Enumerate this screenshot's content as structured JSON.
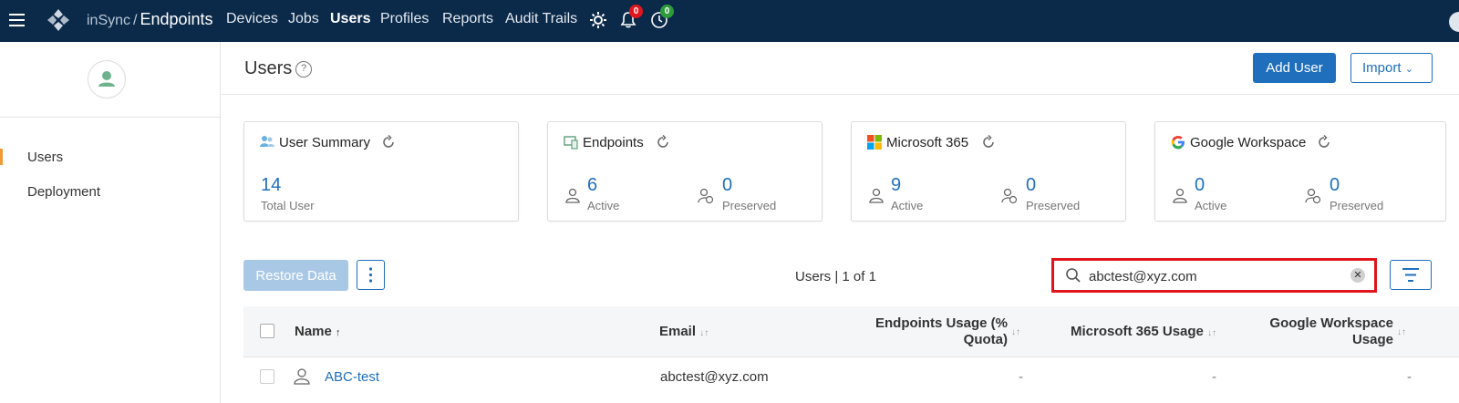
{
  "brand": {
    "prefix": "inSync",
    "separator": "/",
    "product": "Endpoints"
  },
  "nav": [
    "Devices",
    "Jobs",
    "Users",
    "Profiles",
    "Reports",
    "Audit Trails"
  ],
  "nav_active": "Users",
  "badges": {
    "notifications": "0",
    "jobs": "0"
  },
  "colors": {
    "topbar": "#0b2a4a",
    "primary": "#1f6fbd",
    "notif_badge": "#e0151e",
    "jobs_badge": "#2e9a3c",
    "highlight": "#e0151e"
  },
  "sidebar": {
    "items": [
      {
        "label": "Users",
        "active": true
      },
      {
        "label": "Deployment",
        "active": false
      }
    ]
  },
  "page": {
    "title": "Users",
    "add_button": "Add User",
    "import_button": "Import"
  },
  "cards": [
    {
      "title": "User Summary",
      "icon": "users-icon",
      "stats": [
        {
          "value": "14",
          "label": "Total User"
        }
      ]
    },
    {
      "title": "Endpoints",
      "icon": "devices-icon",
      "stats": [
        {
          "value": "6",
          "label": "Active"
        },
        {
          "value": "0",
          "label": "Preserved"
        }
      ]
    },
    {
      "title": "Microsoft 365",
      "icon": "microsoft-logo-icon",
      "stats": [
        {
          "value": "9",
          "label": "Active"
        },
        {
          "value": "0",
          "label": "Preserved"
        }
      ]
    },
    {
      "title": "Google Workspace",
      "icon": "google-logo-icon",
      "stats": [
        {
          "value": "0",
          "label": "Active"
        },
        {
          "value": "0",
          "label": "Preserved"
        }
      ]
    }
  ],
  "toolbar": {
    "restore_label": "Restore Data",
    "count_text": "Users | 1 of 1",
    "search_value": "abctest@xyz.com"
  },
  "table": {
    "columns": [
      "Name",
      "Email",
      "Endpoints Usage (%\nQuota)",
      "Microsoft 365 Usage",
      "Google Workspace\nUsage"
    ],
    "rows": [
      {
        "name": "ABC-test",
        "email": "abctest@xyz.com",
        "endpoints_usage": "-",
        "m365_usage": "-",
        "google_usage": "-"
      }
    ]
  }
}
